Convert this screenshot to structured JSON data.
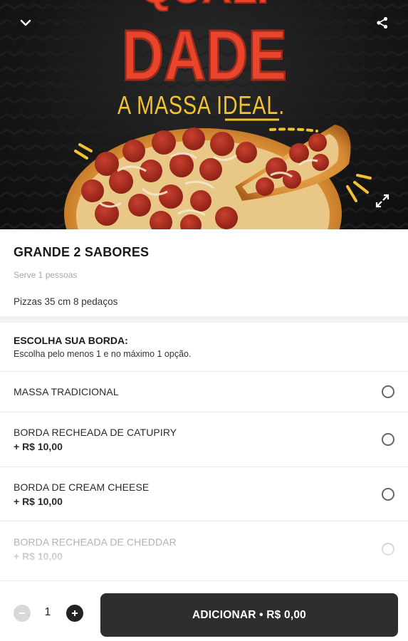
{
  "hero": {
    "headline": "DADE",
    "headline_partial": "QUALI",
    "tagline_prefix": "A MASSA ",
    "tagline_emph": "IDEAL",
    "tagline_suffix": ".",
    "back_icon": "chevron-down-icon",
    "share_icon": "share-icon",
    "expand_icon": "expand-icon",
    "headline_color": "#e8452c",
    "tagline_color": "#f2c230"
  },
  "product": {
    "title": "GRANDE 2 SABORES",
    "serves": "Serve 1 pessoas",
    "description": "Pizzas 35 cm 8 pedaços"
  },
  "section": {
    "title": "ESCOLHA SUA BORDA:",
    "subtitle": "Escolha pelo menos 1 e no máximo 1 opção."
  },
  "options": [
    {
      "label": "MASSA TRADICIONAL",
      "price": ""
    },
    {
      "label": "BORDA RECHEADA DE CATUPIRY",
      "price": "+ R$ 10,00"
    },
    {
      "label": "BORDA DE CREAM CHEESE",
      "price": "+ R$ 10,00"
    },
    {
      "label": "BORDA RECHEADA DE CHEDDAR",
      "price": "+ R$ 10,00"
    }
  ],
  "cart": {
    "quantity": "1",
    "add_label": "ADICIONAR • R$ 0,00"
  }
}
